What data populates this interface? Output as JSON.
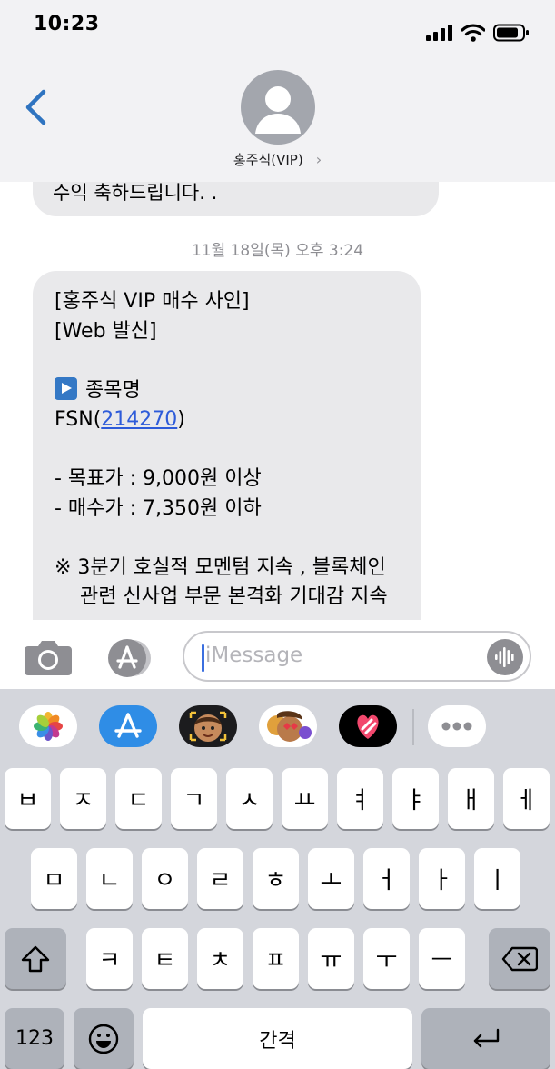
{
  "status_bar": {
    "time": "10:23",
    "icons": [
      "signal-icon",
      "wifi-icon",
      "battery-icon"
    ]
  },
  "header": {
    "contact_name": "홍주식(VIP)",
    "chevron": "›",
    "back_icon": "chevron-left-icon"
  },
  "thread": {
    "previous_message_tail": "수익 축하드립니다. .",
    "timestamp": "11월 18일(목) 오후 3:24",
    "message": {
      "line1": "[홍주식 VIP 매수 사인]",
      "line2": "[Web 발신]",
      "stock_heading": "종목명",
      "stock_prefix": "FSN(",
      "stock_code": "214270",
      "stock_suffix": ")",
      "target_price": "- 목표가 : 9,000원 이상",
      "buy_price": "- 매수가 : 7,350원 이하",
      "note_line1": "※  3분기 호실적 모멘텀 지속 , 블록체인",
      "note_line2": "관련 신사업 부문 본격화 기대감 지속"
    }
  },
  "input_bar": {
    "placeholder": "iMessage"
  },
  "app_strip": {
    "apps": [
      "photos-app-icon",
      "app-store-icon",
      "memoji-icon",
      "animoji-stickers-icon",
      "digital-touch-icon",
      "more-apps-icon"
    ]
  },
  "keyboard": {
    "row1": [
      "ㅂ",
      "ㅈ",
      "ㄷ",
      "ㄱ",
      "ㅅ",
      "ㅛ",
      "ㅕ",
      "ㅑ",
      "ㅐ",
      "ㅔ"
    ],
    "row2": [
      "ㅁ",
      "ㄴ",
      "ㅇ",
      "ㄹ",
      "ㅎ",
      "ㅗ",
      "ㅓ",
      "ㅏ",
      "ㅣ"
    ],
    "row3": [
      "ㅋ",
      "ㅌ",
      "ㅊ",
      "ㅍ",
      "ㅠ",
      "ㅜ",
      "ㅡ"
    ],
    "numbers_key": "123",
    "space_key": "간격"
  },
  "colors": {
    "bubble": "#e9e9eb",
    "link": "#2d5bd9",
    "accent": "#2f74c0",
    "keyboard_bg": "#d4d6dc"
  }
}
